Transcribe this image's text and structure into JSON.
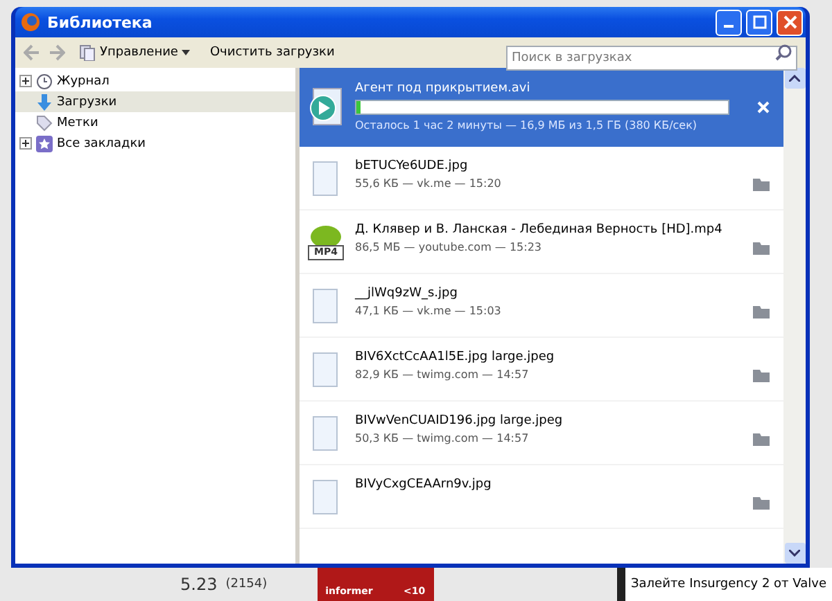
{
  "window": {
    "title": "Библиотека"
  },
  "toolbar": {
    "organize": "Управление",
    "clear": "Очистить загрузки",
    "search": {
      "placeholder": "Поиск в загрузках"
    }
  },
  "sidebar": {
    "items": [
      {
        "label": "Журнал",
        "expandable": true,
        "selected": false
      },
      {
        "label": "Загрузки",
        "expandable": false,
        "selected": true
      },
      {
        "label": "Метки",
        "expandable": false,
        "selected": false
      },
      {
        "label": "Все закладки",
        "expandable": true,
        "selected": false
      }
    ]
  },
  "downloads": [
    {
      "kind": "active",
      "name": "Агент под прикрытием.avi",
      "level": 0.01,
      "status": "Осталось 1 час 2 минуты — 16,9 МБ из 1,5 ГБ (380 КБ/сек)",
      "selected": true
    },
    {
      "kind": "file",
      "name": "bETUCYe6UDE.jpg",
      "meta": "55,6 КБ — vk.me — 15:20",
      "selected": false
    },
    {
      "kind": "video",
      "badge": "MP4",
      "name": "Д. Клявер и В. Ланская - Лебединая Верность [HD].mp4",
      "meta": "86,5 МБ — youtube.com — 15:23",
      "selected": false
    },
    {
      "kind": "file",
      "name": "__jlWq9zW_s.jpg",
      "meta": "47,1 КБ — vk.me — 15:03",
      "selected": false
    },
    {
      "kind": "file",
      "name": "BIV6XctCcAA1l5E.jpg large.jpeg",
      "meta": "82,9 КБ — twimg.com — 14:57",
      "selected": false
    },
    {
      "kind": "file",
      "name": "BIVwVenCUAID196.jpg large.jpeg",
      "meta": "50,3 КБ — twimg.com — 14:57",
      "selected": false
    },
    {
      "kind": "file",
      "name": "BIVyCxgCEAArn9v.jpg",
      "selected": false
    }
  ],
  "background": {
    "rating": "5.23",
    "votes": "(2154)",
    "informer": "informer",
    "informer_count": "<10",
    "banner": "Залейте Insurgency 2 от Valve"
  }
}
